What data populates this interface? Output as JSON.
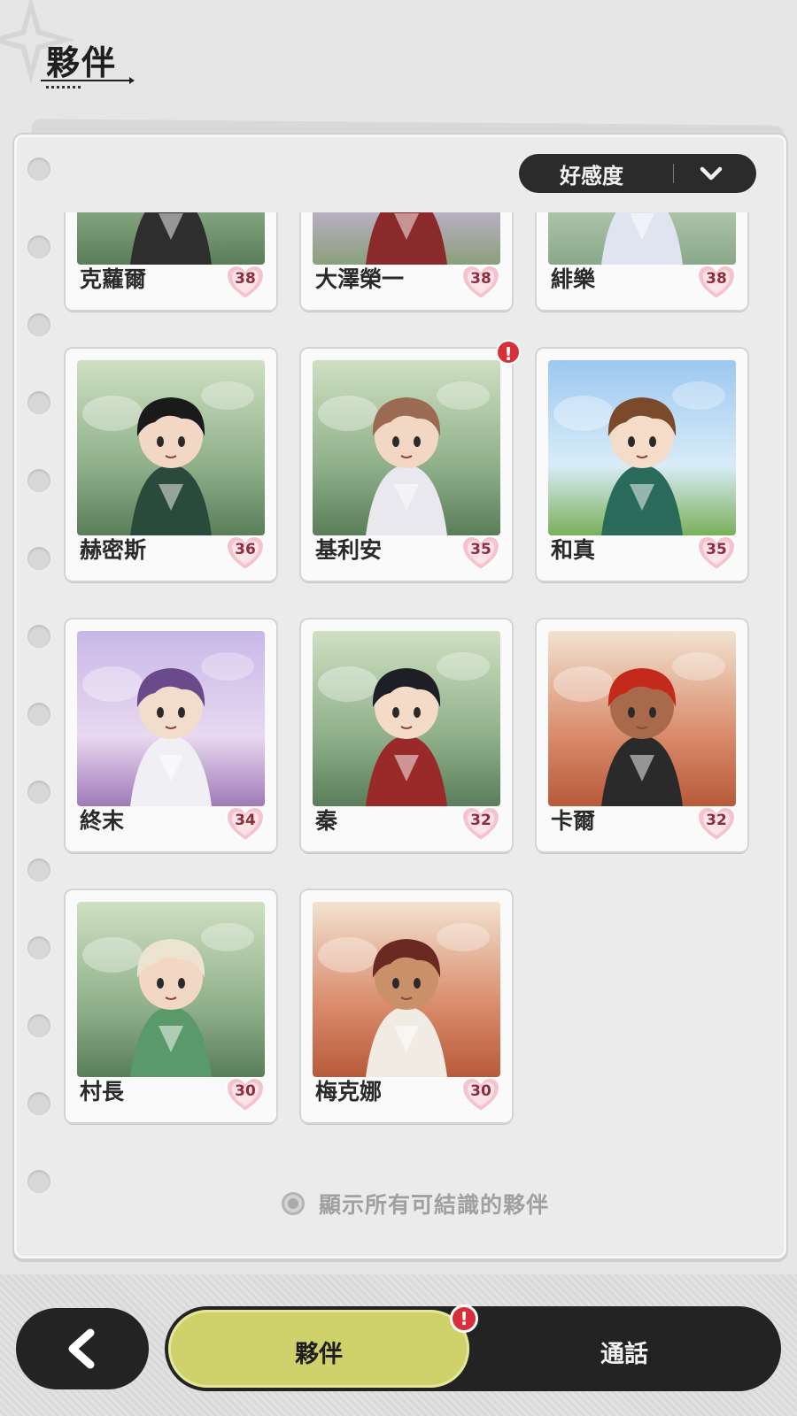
{
  "header": {
    "title": "夥伴"
  },
  "sort": {
    "label": "好感度"
  },
  "companions": [
    {
      "name": "克蘿爾",
      "affinity": "38",
      "alert": false,
      "bg": "forest",
      "hair": "#202020",
      "outfit": "#2e2e2e",
      "skin": "#f2d8c4"
    },
    {
      "name": "大澤榮一",
      "affinity": "38",
      "alert": false,
      "bg": "sakura",
      "hair": "#d9c4a8",
      "outfit": "#8a2a2a",
      "skin": "#f3dac6"
    },
    {
      "name": "緋樂",
      "affinity": "38",
      "alert": false,
      "bg": "ruins",
      "hair": "#f2a7c0",
      "outfit": "#dfe4f0",
      "skin": "#f7e2d2"
    },
    {
      "name": "赫密斯",
      "affinity": "36",
      "alert": false,
      "bg": "forest",
      "hair": "#1a1a1a",
      "outfit": "#2a4a3c",
      "skin": "#f2d8c4"
    },
    {
      "name": "基利安",
      "affinity": "35",
      "alert": true,
      "bg": "forest",
      "hair": "#9a6a52",
      "outfit": "#e8e8ee",
      "skin": "#f2d8c4"
    },
    {
      "name": "和真",
      "affinity": "35",
      "alert": false,
      "bg": "sky",
      "hair": "#7a4a2a",
      "outfit": "#2a6a5a",
      "skin": "#f5dcc8"
    },
    {
      "name": "終末",
      "affinity": "34",
      "alert": false,
      "bg": "purple",
      "hair": "#6a4a8a",
      "outfit": "#f0f0f4",
      "skin": "#f2dccc"
    },
    {
      "name": "秦",
      "affinity": "32",
      "alert": false,
      "bg": "forest",
      "hair": "#1e1e26",
      "outfit": "#9a2a2a",
      "skin": "#f3dbc8"
    },
    {
      "name": "卡爾",
      "affinity": "32",
      "alert": false,
      "bg": "desert",
      "hair": "#c42a1a",
      "outfit": "#2a2a2a",
      "skin": "#a86a4a"
    },
    {
      "name": "村長",
      "affinity": "30",
      "alert": false,
      "bg": "forest",
      "hair": "#ece4d0",
      "outfit": "#5a9a6a",
      "skin": "#f2d8c4"
    },
    {
      "name": "梅克娜",
      "affinity": "30",
      "alert": false,
      "bg": "desert",
      "hair": "#6a2a22",
      "outfit": "#f0ece4",
      "skin": "#c9906a"
    }
  ],
  "show_all": {
    "label": "顯示所有可結識的夥伴"
  },
  "bottom_nav": {
    "tab_companions": "夥伴",
    "tab_calls": "通話",
    "alert_symbol": "!"
  },
  "colors": {
    "accent": "#cfd16b",
    "dark": "#232323",
    "alert": "#d8303a",
    "heart": "#f2aabb"
  },
  "icons": {
    "back": "chevron-left-icon",
    "dropdown": "chevron-down-icon",
    "affinity": "heart-icon",
    "alert": "exclamation-icon"
  }
}
